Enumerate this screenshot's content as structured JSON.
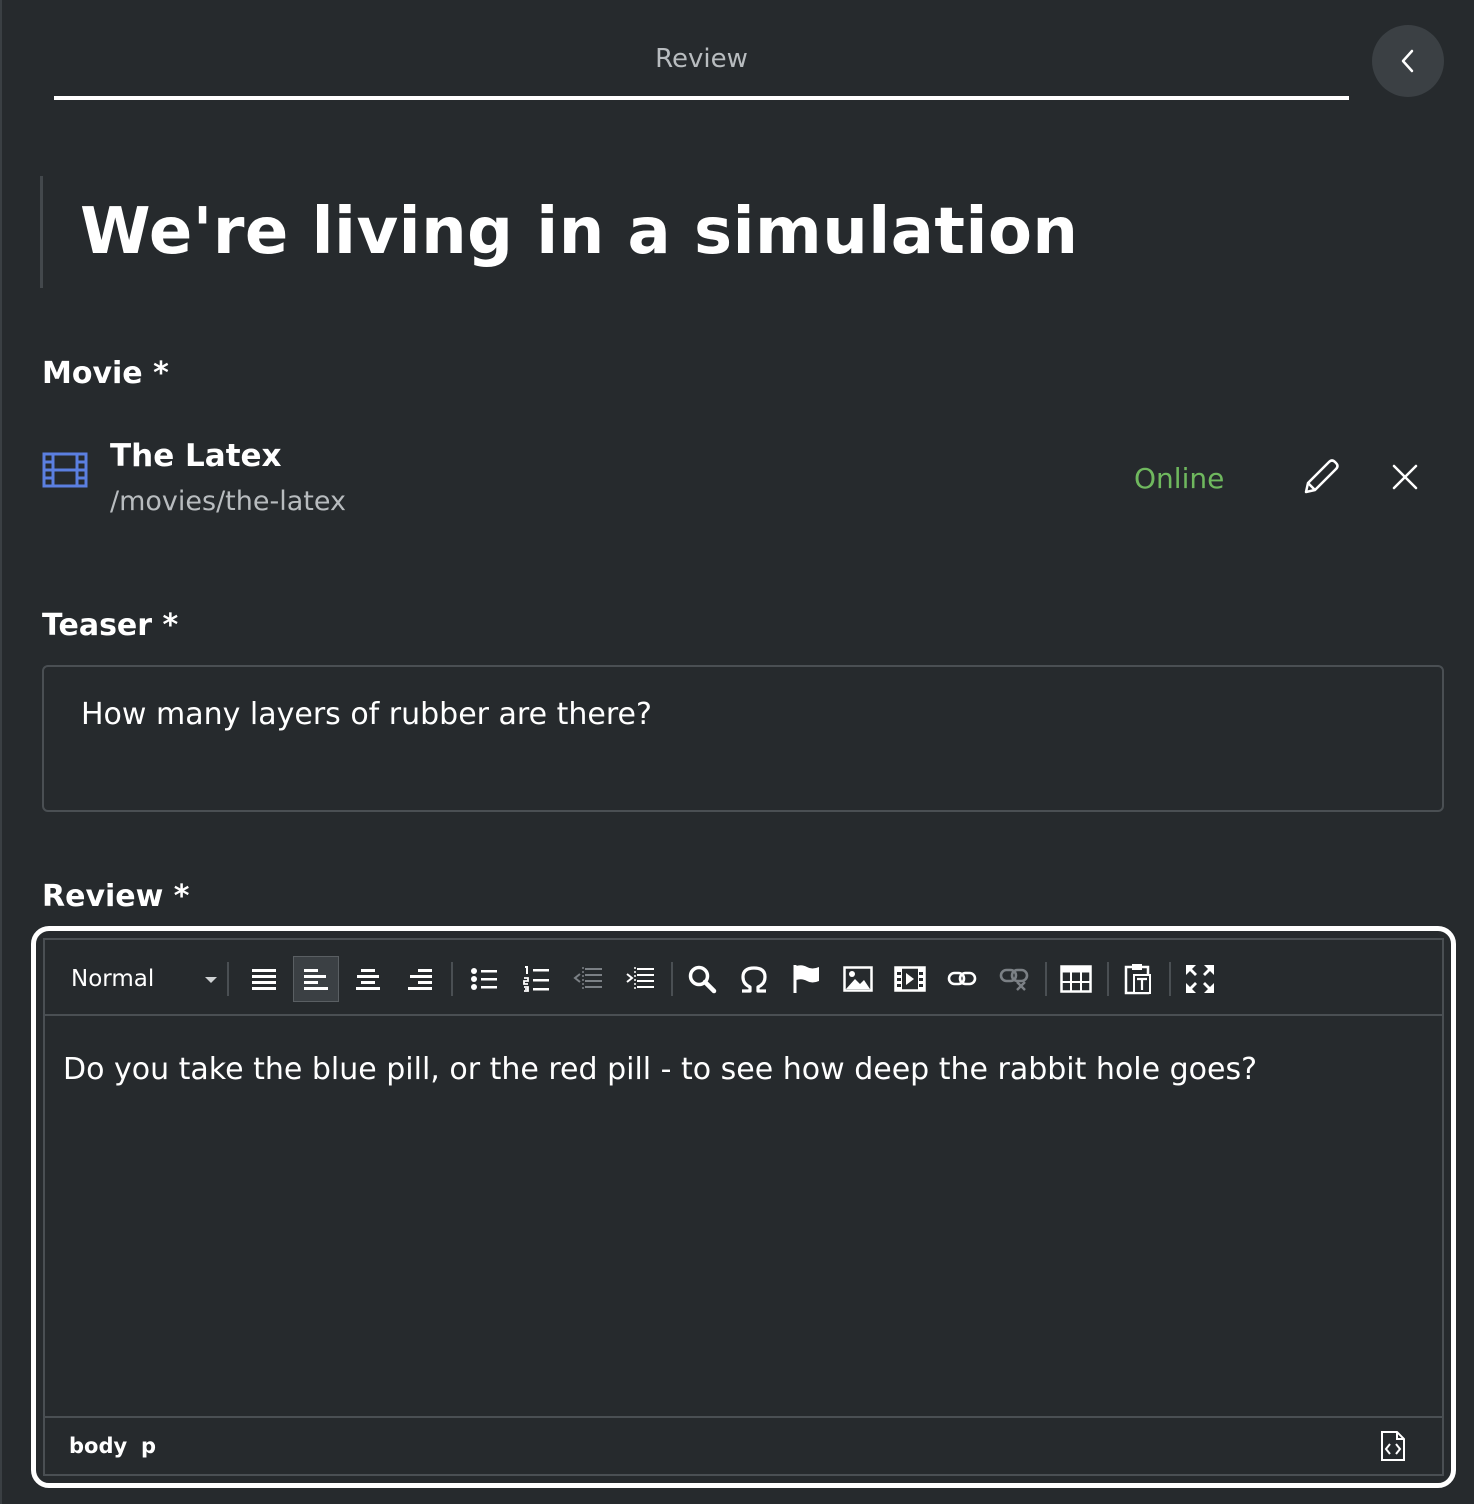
{
  "header": {
    "tab_label": "Review"
  },
  "title": "We're living in a simulation",
  "movie": {
    "label": "Movie *",
    "name": "The Latex",
    "path": "/movies/the-latex",
    "status": "Online",
    "status_color": "#6fb85e",
    "icon": "film-icon"
  },
  "teaser": {
    "label": "Teaser *",
    "value": "How many layers of rubber are there?"
  },
  "review": {
    "label": "Review *",
    "format": "Normal",
    "content": "Do you take the blue pill, or the red pill - to see how deep the rabbit hole goes?",
    "path": [
      "body",
      "p"
    ],
    "toolbar_icons": [
      "justify-icon",
      "align-left-icon",
      "align-center-icon",
      "align-right-icon",
      "bulleted-list-icon",
      "numbered-list-icon",
      "outdent-icon",
      "indent-icon",
      "find-icon",
      "special-char-icon",
      "anchor-flag-icon",
      "image-icon",
      "video-icon",
      "link-icon",
      "unlink-icon",
      "table-icon",
      "paste-text-icon",
      "maximize-icon",
      "source-icon"
    ]
  },
  "colors": {
    "background": "#262a2d",
    "accent": "#5b7fe0",
    "border": "#4a4f53"
  }
}
